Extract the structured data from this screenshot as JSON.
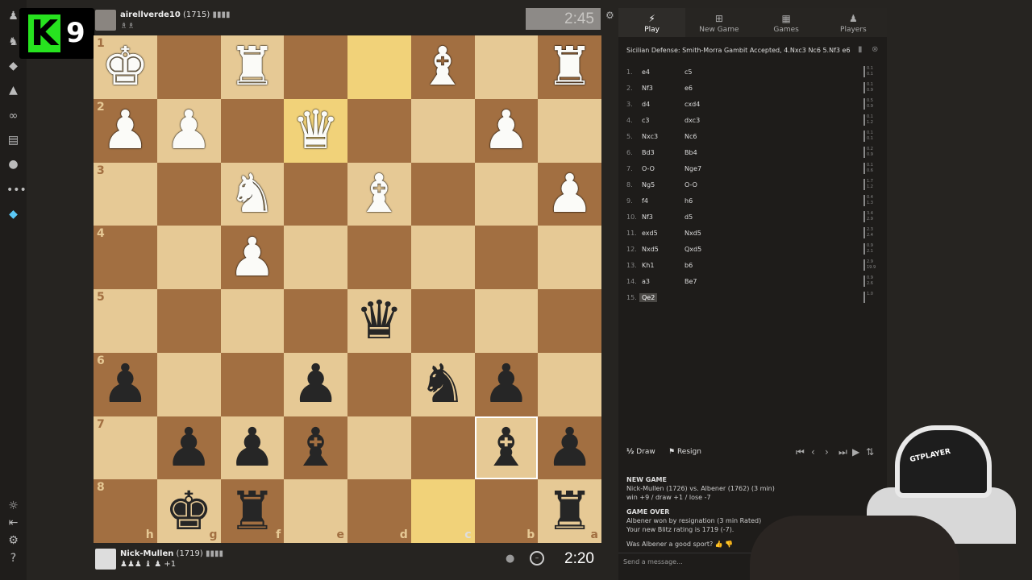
{
  "logo": {
    "letter": "K",
    "number": "9"
  },
  "left_sidebar": {
    "icons": [
      "pawn-icon",
      "puzzle-icon",
      "lessons-icon",
      "learn-icon",
      "watch-icon",
      "news-icon",
      "friends-icon",
      "more-icon",
      "diamond-icon",
      "brightness-icon",
      "collapse-icon",
      "settings-icon",
      "help-icon"
    ]
  },
  "top_player": {
    "name": "airellverde10",
    "rating": "(1715)",
    "captured": "♗♗"
  },
  "top_clock": "2:45",
  "bottom_player": {
    "name": "Nick-Mullen",
    "rating": "(1719)",
    "captured": "♟♟♟ ♝ ♟ +1"
  },
  "bottom_clock": "2:20",
  "board": {
    "ranks": [
      "1",
      "2",
      "3",
      "4",
      "5",
      "6",
      "7",
      "8"
    ],
    "files": [
      "h",
      "g",
      "f",
      "e",
      "d",
      "c",
      "b",
      "a"
    ],
    "squares": [
      [
        "♚w",
        "",
        "♜w",
        "",
        "",
        "♝w",
        "",
        "♜w"
      ],
      [
        "♟w",
        "♟w",
        "",
        "♛w",
        "",
        "",
        "♟w",
        ""
      ],
      [
        "",
        "",
        "♞w",
        "",
        "♝w",
        "",
        "",
        "♟w"
      ],
      [
        "",
        "",
        "♟w",
        "",
        "",
        "",
        "",
        ""
      ],
      [
        "",
        "",
        "",
        "",
        "♛b",
        "",
        "",
        ""
      ],
      [
        "♟b",
        "",
        "",
        "♟b",
        "",
        "♞b",
        "♟b",
        ""
      ],
      [
        "",
        "♟b",
        "♟b",
        "♝b",
        "",
        "",
        "♝b",
        "♟b"
      ],
      [
        "",
        "♚b",
        "♜b",
        "",
        "",
        "",
        "",
        "♜b"
      ]
    ]
  },
  "tabs": [
    {
      "label": "Play",
      "icon": "bolt-icon"
    },
    {
      "label": "New Game",
      "icon": "plus-icon"
    },
    {
      "label": "Games",
      "icon": "board-icon"
    },
    {
      "label": "Players",
      "icon": "players-icon"
    }
  ],
  "opening": "Sicilian Defense: Smith-Morra Gambit Accepted, 4.Nxc3 Nc6 5.Nf3 e6",
  "moves": [
    {
      "n": "1.",
      "w": "e4",
      "b": "c5",
      "e1": "0.1",
      "e2": "0.1"
    },
    {
      "n": "2.",
      "w": "Nf3",
      "b": "e6",
      "e1": "0.1",
      "e2": "0.9"
    },
    {
      "n": "3.",
      "w": "d4",
      "b": "cxd4",
      "e1": "0.5",
      "e2": "0.9"
    },
    {
      "n": "4.",
      "w": "c3",
      "b": "dxc3",
      "e1": "0.1",
      "e2": "1.2"
    },
    {
      "n": "5.",
      "w": "Nxc3",
      "b": "Nc6",
      "e1": "0.1",
      "e2": "0.1"
    },
    {
      "n": "6.",
      "w": "Bd3",
      "b": "Bb4",
      "e1": "0.2",
      "e2": "0.9"
    },
    {
      "n": "7.",
      "w": "O-O",
      "b": "Nge7",
      "e1": "0.1",
      "e2": "0.6"
    },
    {
      "n": "8.",
      "w": "Ng5",
      "b": "O-O",
      "e1": "1.7",
      "e2": "1.2"
    },
    {
      "n": "9.",
      "w": "f4",
      "b": "h6",
      "e1": "0.4",
      "e2": "1.3"
    },
    {
      "n": "10.",
      "w": "Nf3",
      "b": "d5",
      "e1": "3.4",
      "e2": "2.9"
    },
    {
      "n": "11.",
      "w": "exd5",
      "b": "Nxd5",
      "e1": "2.3",
      "e2": "2.4"
    },
    {
      "n": "12.",
      "w": "Nxd5",
      "b": "Qxd5",
      "e1": "0.9",
      "e2": "2.1"
    },
    {
      "n": "13.",
      "w": "Kh1",
      "b": "b6",
      "e1": "2.9",
      "e2": "19.9"
    },
    {
      "n": "14.",
      "w": "a3",
      "b": "Be7",
      "e1": "0.9",
      "e2": "2.6"
    },
    {
      "n": "15.",
      "w": "Qe2",
      "b": "",
      "e1": "1.0",
      "e2": ""
    }
  ],
  "actions": {
    "draw": "Draw",
    "resign": "Resign",
    "half": "½"
  },
  "chat": {
    "new_game_header": "NEW GAME",
    "new_game_line": "Nick-Mullen (1726) vs. Albener (1762) (3 min)",
    "new_game_odds": "win +9 / draw +1 / lose -7",
    "game_over_header": "GAME OVER",
    "game_over_line": "Albener won by resignation (3 min Rated)",
    "rating_line": "Your new Blitz rating is 1719 (-7).",
    "question": "Was Albener a good sport?",
    "input_placeholder": "Send a message..."
  },
  "webcam": {
    "chair_text": "GTPLAYER"
  },
  "colors": {
    "light_square": "#e6c995",
    "dark_square": "#a26f41",
    "highlight": "#f1d279",
    "logo_green": "#27e31f"
  }
}
